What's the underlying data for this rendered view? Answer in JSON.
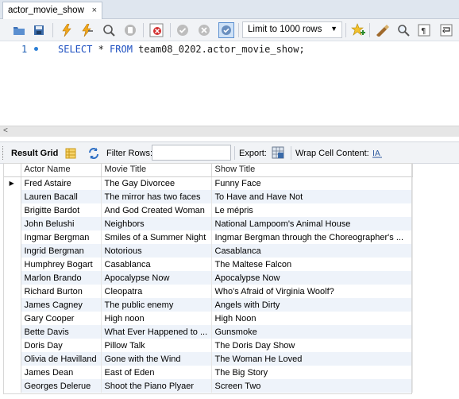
{
  "tab": {
    "title": "actor_movie_show",
    "close": "×"
  },
  "toolbar": {
    "limit_label": "Limit to 1000 rows",
    "icons": [
      "open-folder-icon",
      "save-icon",
      "execute-icon",
      "execute-current-icon",
      "explain-icon",
      "stop-icon",
      "toggle-error-icon",
      "commit-icon",
      "rollback-icon",
      "autocommit-icon",
      "beautify-icon",
      "find-icon",
      "invisible-chars-icon",
      "wrap-icon"
    ]
  },
  "editor": {
    "line_number": "1",
    "code": {
      "select": "SELECT",
      "star": " * ",
      "from": "FROM",
      "rest": " team08_0202.actor_movie_show;"
    }
  },
  "result_toolbar": {
    "result_grid": "Result Grid",
    "filter_rows": "Filter Rows:",
    "export": "Export:",
    "wrap_cell": "Wrap Cell Content:"
  },
  "grid": {
    "columns": [
      "Actor Name",
      "Movie Title",
      "Show Title"
    ],
    "rows": [
      [
        "Fred Astaire",
        "The Gay Divorcee",
        "Funny Face"
      ],
      [
        "Lauren Bacall",
        "The mirror has two faces",
        "To Have and Have Not"
      ],
      [
        "Brigitte Bardot",
        "And God Created Woman",
        "Le mépris"
      ],
      [
        "John Belushi",
        "Neighbors",
        "National Lampoom's Animal House"
      ],
      [
        "Ingmar Bergman",
        "Smiles of a Summer Night",
        "Ingmar Bergman through the Choreographer's ..."
      ],
      [
        "Ingrid Bergman",
        "Notorious",
        "Casablanca"
      ],
      [
        "Humphrey Bogart",
        "Casablanca",
        "The Maltese Falcon"
      ],
      [
        "Marlon Brando",
        "Apocalypse Now",
        "Apocalypse Now"
      ],
      [
        "Richard Burton",
        "Cleopatra",
        "Who's Afraid of Virginia Woolf?"
      ],
      [
        "James Cagney",
        "The public enemy",
        "Angels with Dirty"
      ],
      [
        "Gary Cooper",
        "High noon",
        "High Noon"
      ],
      [
        "Bette Davis",
        "What Ever Happened to ...",
        "Gunsmoke"
      ],
      [
        "Doris Day",
        "Pillow Talk",
        "The Doris Day Show"
      ],
      [
        "Olivia de Havilland",
        "Gone with the Wind",
        "The Woman He Loved"
      ],
      [
        "James Dean",
        "East of Eden",
        "The Big Story"
      ],
      [
        "Georges Delerue",
        "Shoot the Piano Plyaer",
        "Screen Two"
      ]
    ]
  },
  "colors": {
    "keyword": "#1d4fc0",
    "alt_row": "#eef3fa",
    "tabbar": "#dfe6ef",
    "toolbar": "#f1f3f6"
  }
}
